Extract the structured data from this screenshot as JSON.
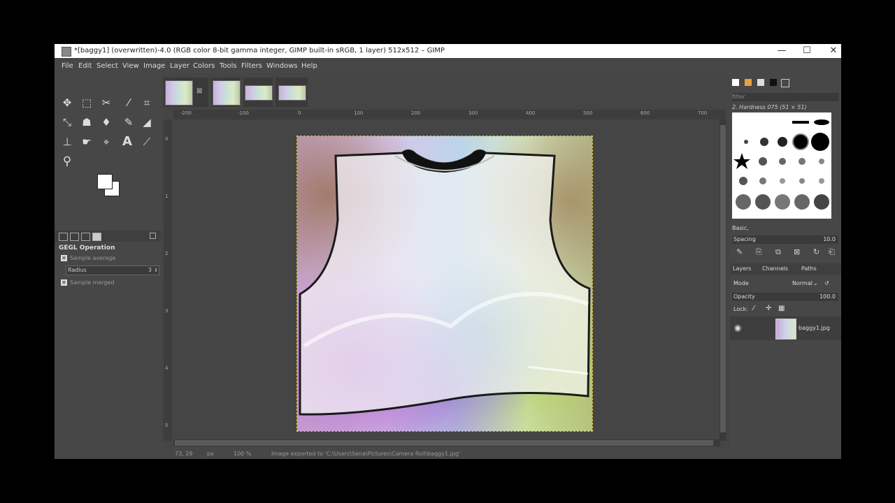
{
  "window": {
    "title": "*[baggy1] (overwritten)-4.0 (RGB color 8-bit gamma integer, GIMP built-in sRGB, 1 layer) 512x512 – GIMP",
    "minimize_glyph": "—",
    "maximize_glyph": "☐",
    "close_glyph": "✕"
  },
  "menu": [
    "File",
    "Edit",
    "Select",
    "View",
    "Image",
    "Layer",
    "Colors",
    "Tools",
    "Filters",
    "Windows",
    "Help"
  ],
  "tool_options": {
    "title": "GEGL Operation",
    "sample_average": "Sample average",
    "radius_label": "Radius",
    "radius_value": "3",
    "sample_merged": "Sample merged"
  },
  "rulers": {
    "h_ticks": [
      "-200",
      "-100",
      "0",
      "100",
      "200",
      "300",
      "400",
      "500",
      "600",
      "700"
    ],
    "v_ticks": [
      "0",
      "1",
      "2",
      "3",
      "4",
      "5"
    ]
  },
  "statusbar": {
    "coords": "73, 29",
    "unit": "px",
    "zoom": "100 %",
    "message": "Image exported to 'C:\\Users\\Sena\\Pictures\\Camera Roll\\baggy1.jpg'"
  },
  "brushes": {
    "filter_placeholder": "filter",
    "current": "2. Hardness 075 (51 × 51)",
    "preset": "Basic,",
    "spacing_label": "Spacing",
    "spacing_value": "10.0"
  },
  "layers": {
    "tabs": [
      "Layers",
      "Channels",
      "Paths"
    ],
    "mode_label": "Mode",
    "mode_value": "Normal",
    "opacity_label": "Opacity",
    "opacity_value": "100.0",
    "lock_label": "Lock:",
    "items": [
      {
        "name": "baggy1.jpg"
      }
    ]
  },
  "colors": {
    "ui_bg": "#454545",
    "panel_bg": "#474747",
    "selection_outline": "#d8c040"
  },
  "icons": {
    "tools": [
      "move-icon",
      "rect-select-icon",
      "scissors-icon",
      "fuzzy-select-icon",
      "crop-icon",
      "warp-icon",
      "bucket-fill-icon",
      "paint-icon",
      "brush-icon",
      "eraser-icon",
      "clone-icon",
      "smudge-icon",
      "path-icon",
      "text-icon",
      "color-picker-icon",
      "zoom-icon"
    ]
  }
}
